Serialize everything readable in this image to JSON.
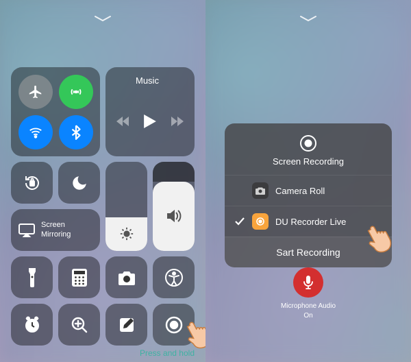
{
  "left": {
    "music_label": "Music",
    "screen_mirroring": "Screen\nMirroring",
    "hint": "Press and hold"
  },
  "right": {
    "popup_title": "Screen Recording",
    "option_camera": "Camera Roll",
    "option_du": "DU Recorder Live",
    "start_label": "Sart Recording",
    "mic_label_line1": "Microphone Audio",
    "mic_label_line2": "On"
  }
}
